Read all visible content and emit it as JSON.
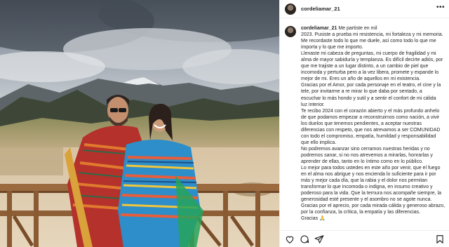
{
  "post": {
    "username": "cordeliamar_21",
    "more_icon": "more-horizontal-icon",
    "caption_lines": [
      "Me partiste en mil",
      "2023. Pusiste a prueba mi resistencia, mi fortaleza y mi memoria.",
      "Me recordaste todo lo que me duele, así como todo lo que me",
      "importa y lo que me importo.",
      "Llenaste mi cabeza de preguntas, mi cuerpo de fragilidad y mi",
      "alma de mayor sabiduría y templanza. Es difícil decirte adiós, por",
      "que me trajiste a un lugar distinto, a un cambio de piel que",
      "incomoda y perturba pero a la vez libera, promete y expande lo",
      "mejor de mi. Eres un año de aquellos en mi existencia.",
      "Gracias por el Amor, por cada personaje en el teatro, el cine y la",
      "tele, por invitarme a re mirar lo que daba por sentado, a",
      "escuchar lo más hondo y sutil y a sentir el confort de mi cálida",
      "luz interior.",
      "Te recibo 2024 con el corazón abierto y el más profundo anhelo",
      "de que podamos empezar a reconstruirnos como nación, a vivir",
      "los duelos que tenemos pendientes, a aceptar nuestras",
      "diferencias con respeto, que nos atrevamos a ser COMUNIDAD",
      "con todo el compromiso, empatía, humildad y responsabilidad",
      "que ello implica.",
      "No podremos avanzar sino cerramos nuestras heridas y no",
      "podremos sanar, si no nos atrevemos a mirarlas, honrarlas y",
      "aprender de ellas, tanto en lo íntimo como en lo público.",
      "Lo mejor para todos ustedes en este año por venir, que el fuego",
      "en el alma nos abrigue y nos encienda lo suficiente para ir por",
      "más y mejor cada día, que la rabia y el dolor nos permitan",
      "transformar lo que incomoda o indigna, en insumo creativo y",
      "poderoso para la vida. Que la ternura nos acompañe siempre, la",
      "generosidad esté presente y el asombro no se agote nunca.",
      "Gracias por el aprecio, por cada mirada cálida y generoso abrazo,",
      "por la confianza, la crítica, la empatía y las diferencias.",
      "Gracias 🙏"
    ]
  },
  "actions": {
    "like_icon": "heart-icon",
    "comment_icon": "comment-icon",
    "share_icon": "share-icon",
    "save_icon": "bookmark-icon"
  }
}
